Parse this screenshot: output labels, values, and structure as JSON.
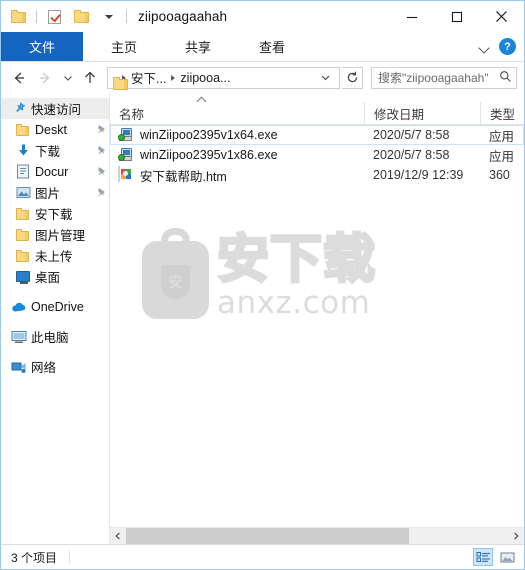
{
  "window": {
    "title": "ziipooagaahah",
    "quick_access": [
      {
        "name": "folder-icon",
        "label": ""
      },
      {
        "name": "properties-icon",
        "label": ""
      },
      {
        "name": "new-folder-icon",
        "label": ""
      },
      {
        "name": "customize-caret-icon",
        "label": ""
      }
    ],
    "caption": {
      "minimize": "—",
      "maximize": "□",
      "close": "✕"
    }
  },
  "ribbon": {
    "tabs": [
      {
        "id": "file",
        "label": "文件",
        "active": true
      },
      {
        "id": "home",
        "label": "主页",
        "active": false
      },
      {
        "id": "share",
        "label": "共享",
        "active": false
      },
      {
        "id": "view",
        "label": "查看",
        "active": false
      }
    ],
    "expand_icon": "chevron-down-icon",
    "help_label": "?"
  },
  "address": {
    "back_icon": "←",
    "forward_icon": "→",
    "recent_caret": "⌵",
    "up_icon": "↑",
    "crumbs": [
      "安下...",
      "ziipooa..."
    ],
    "refresh_icon": "↻"
  },
  "search": {
    "placeholder": "搜索\"ziipooagaahah\"",
    "icon": "search-icon"
  },
  "sidebar": {
    "items": [
      {
        "label": "快速访问",
        "icon": "star-pin-icon",
        "selected": true,
        "pinned": false,
        "root": true
      },
      {
        "label": "Deskt",
        "icon": "folder-icon",
        "selected": false,
        "pinned": true,
        "root": false
      },
      {
        "label": "下载",
        "icon": "download-icon",
        "selected": false,
        "pinned": true,
        "root": false
      },
      {
        "label": "Docur",
        "icon": "documents-icon",
        "selected": false,
        "pinned": true,
        "root": false
      },
      {
        "label": "图片",
        "icon": "pictures-icon",
        "selected": false,
        "pinned": true,
        "root": false
      },
      {
        "label": "安下载",
        "icon": "folder-icon",
        "selected": false,
        "pinned": false,
        "root": false
      },
      {
        "label": "图片管理",
        "icon": "folder-icon",
        "selected": false,
        "pinned": false,
        "root": false
      },
      {
        "label": "未上传",
        "icon": "folder-icon",
        "selected": false,
        "pinned": false,
        "root": false
      },
      {
        "label": "桌面",
        "icon": "desktop-icon",
        "selected": false,
        "pinned": false,
        "root": false
      }
    ],
    "roots": [
      {
        "label": "OneDrive",
        "icon": "onedrive-icon"
      },
      {
        "label": "此电脑",
        "icon": "this-pc-icon"
      },
      {
        "label": "网络",
        "icon": "network-icon"
      }
    ]
  },
  "filelist": {
    "sort_indicator": "ascending",
    "columns": [
      {
        "id": "name",
        "label": "名称"
      },
      {
        "id": "date",
        "label": "修改日期"
      },
      {
        "id": "type",
        "label": "类型"
      }
    ],
    "rows": [
      {
        "name": "winZiipoo2395v1x64.exe",
        "date": "2020/5/7 8:58",
        "type": "应用",
        "icon": "installer-icon",
        "focused": true
      },
      {
        "name": "winZiipoo2395v1x86.exe",
        "date": "2020/5/7 8:58",
        "type": "应用",
        "icon": "installer-icon",
        "focused": false
      },
      {
        "name": "安下载帮助.htm",
        "date": "2019/12/9 12:39",
        "type": "360",
        "icon": "browser-icon",
        "focused": false
      }
    ]
  },
  "watermark": {
    "shield_char": "安",
    "cn_text": "安下载",
    "en_text": "anxz.com"
  },
  "statusbar": {
    "item_count": "3 个项目",
    "view_details_icon": "details-view-icon",
    "view_large_icon": "large-icons-view-icon"
  },
  "colors": {
    "accent": "#1565c0",
    "window_border": "#9ac8e8",
    "selection": "#cfe6f7",
    "folder": "#fbd77e"
  }
}
